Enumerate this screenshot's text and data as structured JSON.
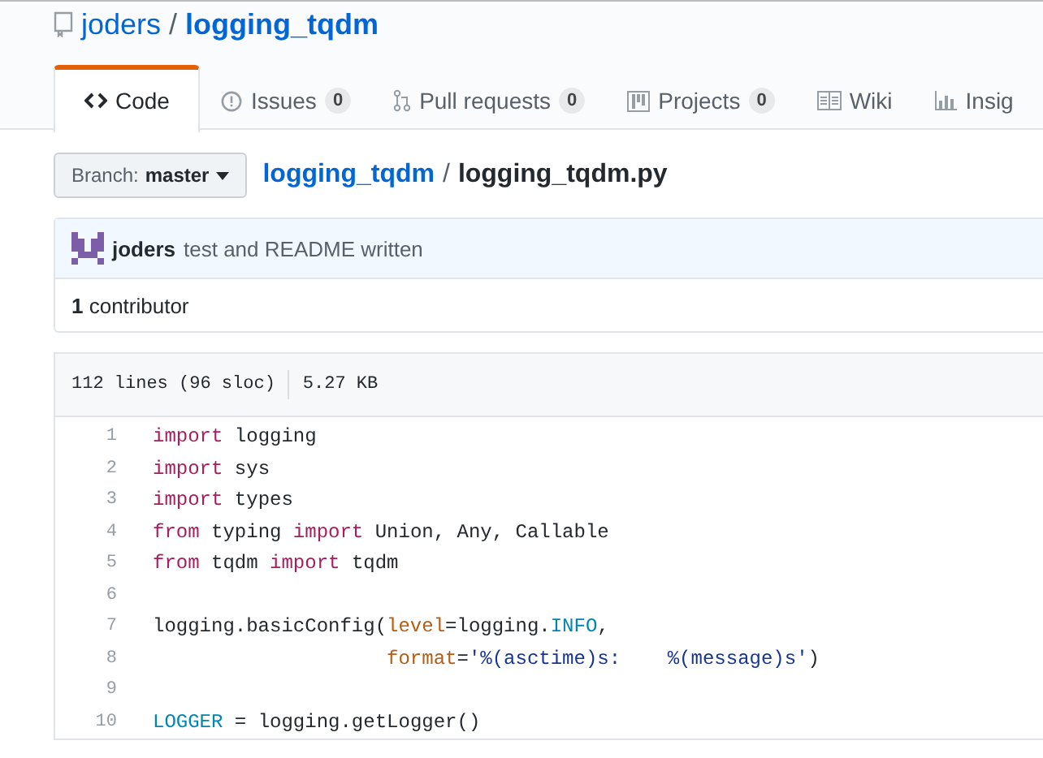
{
  "repo": {
    "owner": "joders",
    "separator": "/",
    "name": "logging_tqdm"
  },
  "tabs": [
    {
      "label": "Code",
      "selected": true
    },
    {
      "label": "Issues",
      "count": "0",
      "selected": false
    },
    {
      "label": "Pull requests",
      "count": "0",
      "selected": false
    },
    {
      "label": "Projects",
      "count": "0",
      "selected": false
    },
    {
      "label": "Wiki",
      "selected": false
    },
    {
      "label": "Insig",
      "selected": false
    }
  ],
  "branch": {
    "label": "Branch:",
    "value": "master"
  },
  "breadcrumb": {
    "repo": "logging_tqdm",
    "separator": "/",
    "file": "logging_tqdm.py"
  },
  "commit": {
    "author": "joders",
    "message": "test and README written"
  },
  "contributors": {
    "count": "1",
    "label": "contributor"
  },
  "file_info": {
    "lines": "112 lines (96 sloc)",
    "size": "5.27 KB"
  },
  "code": [
    {
      "number": "1",
      "tokens": [
        {
          "kind": "kw",
          "text": "import"
        },
        {
          "kind": "plain",
          "text": " logging"
        }
      ]
    },
    {
      "number": "2",
      "tokens": [
        {
          "kind": "kw",
          "text": "import"
        },
        {
          "kind": "plain",
          "text": " sys"
        }
      ]
    },
    {
      "number": "3",
      "tokens": [
        {
          "kind": "kw",
          "text": "import"
        },
        {
          "kind": "plain",
          "text": " types"
        }
      ]
    },
    {
      "number": "4",
      "tokens": [
        {
          "kind": "kw",
          "text": "from"
        },
        {
          "kind": "plain",
          "text": " typing "
        },
        {
          "kind": "kw",
          "text": "import"
        },
        {
          "kind": "plain",
          "text": " Union, Any, Callable"
        }
      ]
    },
    {
      "number": "5",
      "tokens": [
        {
          "kind": "kw",
          "text": "from"
        },
        {
          "kind": "plain",
          "text": " tqdm "
        },
        {
          "kind": "kw",
          "text": "import"
        },
        {
          "kind": "plain",
          "text": " tqdm"
        }
      ]
    },
    {
      "number": "6"
    },
    {
      "number": "7",
      "tokens": [
        {
          "kind": "plain",
          "text": "logging.basicConfig("
        },
        {
          "kind": "param",
          "text": "level"
        },
        {
          "kind": "plain",
          "text": "=logging."
        },
        {
          "kind": "const",
          "text": "INFO"
        },
        {
          "kind": "plain",
          "text": ","
        }
      ]
    },
    {
      "number": "8",
      "kind": "continuation",
      "tokens": [
        {
          "kind": "param",
          "text": "format"
        },
        {
          "kind": "plain",
          "text": "="
        },
        {
          "kind": "str",
          "text": "'%(asctime)s:    %(message)s'"
        },
        {
          "kind": "plain",
          "text": ")"
        }
      ]
    },
    {
      "number": "9"
    },
    {
      "number": "10",
      "tokens": [
        {
          "kind": "const",
          "text": "LOGGER"
        },
        {
          "kind": "plain",
          "text": " = logging.getLogger()"
        }
      ]
    }
  ]
}
